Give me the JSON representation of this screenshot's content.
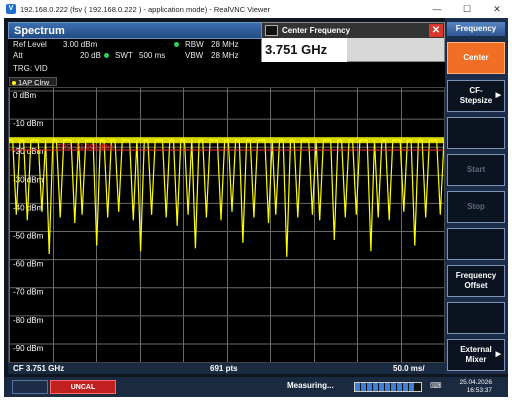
{
  "window": {
    "title": "192.168.0.222 (fsv ( 192.168.0.222 ) - application mode) - RealVNC Viewer",
    "minimize_glyph": "—",
    "maximize_glyph": "☐",
    "close_glyph": "✕"
  },
  "spectrum": {
    "title": "Spectrum",
    "ref_level_label": "Ref Level",
    "ref_level_value": "3.00 dBm",
    "att_label": "Att",
    "att_value": "20 dB",
    "swt_label": "SWT",
    "swt_value": "500 ms",
    "rbw_label": "RBW",
    "rbw_value": "28 MHz",
    "vbw_label": "VBW",
    "vbw_value": "28 MHz",
    "trg_label": "TRG: VID",
    "trace_label": "1AP Clrw",
    "trg_line_label": "TRG -21.000 dBm",
    "y_ticks": [
      "0 dBm",
      "-10 dBm",
      "-20 dBm",
      "-30 dBm",
      "-40 dBm",
      "-50 dBm",
      "-60 dBm",
      "-70 dBm",
      "-80 dBm",
      "-90 dBm"
    ],
    "footer_cf": "CF 3.751 GHz",
    "footer_pts": "691 pts",
    "footer_span": "50.0 ms/"
  },
  "center_frequency_dialog": {
    "title": "Center Frequency",
    "value": "3.751 GHz",
    "close_glyph": "✕"
  },
  "softkeys": {
    "header": "Frequency",
    "items": [
      {
        "label": "Center",
        "state": "active"
      },
      {
        "label": "CF-\nStepsize",
        "state": "normal",
        "arrow": true
      },
      {
        "label": "",
        "state": "dim"
      },
      {
        "label": "Start",
        "state": "dim"
      },
      {
        "label": "Stop",
        "state": "dim"
      },
      {
        "label": "",
        "state": "dim"
      },
      {
        "label": "Frequency\nOffset",
        "state": "normal"
      },
      {
        "label": "",
        "state": "dim"
      },
      {
        "label": "External\nMixer",
        "state": "normal",
        "arrow": true
      }
    ]
  },
  "status": {
    "uncal": "UNCAL",
    "measuring": "Measuring...",
    "date": "25.04.2026",
    "time": "16:53:37",
    "progress": 0.9
  },
  "chart_data": {
    "type": "line",
    "title": "",
    "xlabel": "",
    "ylabel": "",
    "ylim": [
      -95,
      0
    ],
    "reference_level_dbm": 3.0,
    "trigger_level_dbm": -21.0,
    "points": 691,
    "x_unit": "ms",
    "x_span_per_div": 50.0,
    "center_frequency": "3.751 GHz",
    "series": [
      {
        "color": "#ffff00",
        "description": "dense bursting trace: flat top near -17.5 dBm, frequent drops to about -45 dBm, occasional dips to about -58 dBm",
        "values": [
          -17.5,
          -17.5,
          -44,
          -17.5,
          -17.5,
          -46,
          -17.5,
          -17.5,
          -17.5,
          -43,
          -17.5,
          -58,
          -17.5,
          -17.5,
          -45,
          -17.5,
          -17.5,
          -17.5,
          -47,
          -17.5,
          -44,
          -17.5,
          -17.5,
          -17.5,
          -55,
          -17.5,
          -17.5,
          -45,
          -17.5,
          -17.5,
          -43,
          -17.5,
          -17.5,
          -17.5,
          -46,
          -17.5,
          -57,
          -17.5,
          -17.5,
          -44,
          -17.5,
          -17.5,
          -17.5,
          -45,
          -17.5,
          -17.5,
          -48,
          -17.5,
          -17.5,
          -44,
          -17.5,
          -56,
          -17.5,
          -17.5,
          -45,
          -17.5,
          -17.5,
          -17.5,
          -46,
          -17.5,
          -17.5,
          -43,
          -17.5,
          -17.5,
          -54,
          -17.5,
          -17.5,
          -45,
          -17.5,
          -17.5,
          -17.5,
          -47,
          -17.5,
          -44,
          -17.5,
          -17.5,
          -59,
          -17.5,
          -17.5,
          -45,
          -17.5,
          -17.5,
          -17.5,
          -44,
          -17.5,
          -46,
          -17.5,
          -17.5,
          -17.5,
          -53,
          -17.5,
          -17.5,
          -45,
          -17.5,
          -17.5,
          -44,
          -17.5,
          -17.5,
          -17.5,
          -57,
          -17.5,
          -45,
          -17.5,
          -17.5,
          -46,
          -17.5,
          -17.5,
          -17.5,
          -43,
          -17.5,
          -17.5,
          -55,
          -17.5,
          -17.5,
          -45,
          -17.5,
          -17.5,
          -17.5,
          -44,
          -17.5
        ]
      }
    ]
  }
}
